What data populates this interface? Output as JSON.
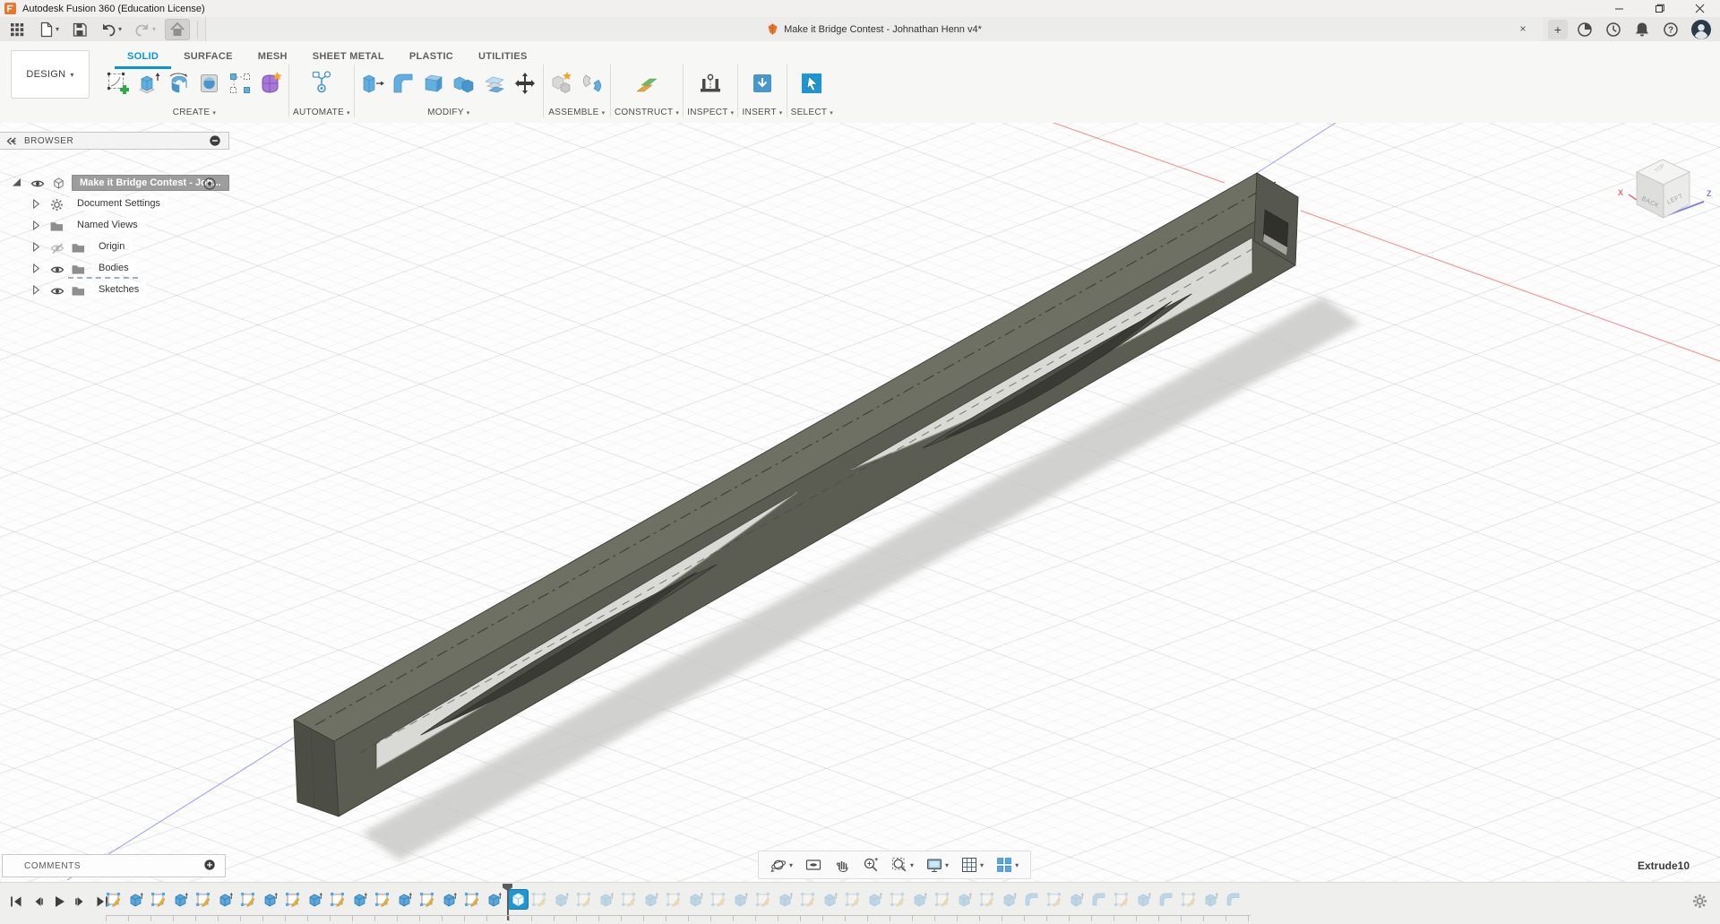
{
  "window": {
    "title": "Autodesk Fusion 360 (Education License)",
    "controls": [
      "minimize",
      "maximize",
      "close"
    ]
  },
  "appbar": {
    "left_icons": [
      {
        "name": "app-grid",
        "caret": false,
        "disabled": false
      },
      {
        "name": "file",
        "caret": true,
        "disabled": false
      },
      {
        "name": "save",
        "caret": false,
        "disabled": false
      },
      {
        "name": "undo",
        "caret": true,
        "disabled": false
      },
      {
        "name": "redo",
        "caret": true,
        "disabled": true
      },
      {
        "name": "home",
        "caret": false,
        "disabled": true
      }
    ],
    "tab": {
      "title": "Make it Bridge Contest - Johnathan Henn v4*",
      "icon": "document-cube",
      "close_label": "×"
    },
    "new_tab_label": "+",
    "right_icons": [
      "extensions",
      "job-status",
      "notifications",
      "help",
      "profile"
    ]
  },
  "ribbon": {
    "workspace_label": "DESIGN",
    "tabs": [
      {
        "label": "SOLID",
        "active": true
      },
      {
        "label": "SURFACE",
        "active": false
      },
      {
        "label": "MESH",
        "active": false
      },
      {
        "label": "SHEET METAL",
        "active": false
      },
      {
        "label": "PLASTIC",
        "active": false
      },
      {
        "label": "UTILITIES",
        "active": false
      }
    ],
    "groups": [
      {
        "label": "CREATE",
        "icons": [
          "create-sketch",
          "extrude",
          "revolve",
          "hole",
          "pattern",
          "create-form"
        ]
      },
      {
        "label": "AUTOMATE",
        "icons": [
          "automate"
        ]
      },
      {
        "label": "MODIFY",
        "icons": [
          "press-pull",
          "fillet",
          "shell",
          "combine",
          "split-body",
          "move"
        ]
      },
      {
        "label": "ASSEMBLE",
        "icons": [
          "new-component",
          "joint"
        ]
      },
      {
        "label": "CONSTRUCT",
        "icons": [
          "construct-plane"
        ]
      },
      {
        "label": "INSPECT",
        "icons": [
          "measure"
        ]
      },
      {
        "label": "INSERT",
        "icons": [
          "insert-mesh"
        ]
      },
      {
        "label": "SELECT",
        "icons": [
          "select-tool"
        ]
      }
    ]
  },
  "browser": {
    "header": "BROWSER",
    "items": [
      {
        "label": "Make it Bridge Contest - Joh...",
        "icon": "component-box",
        "caret": "expanded",
        "eye": "visible",
        "selected": true,
        "target": true,
        "indent": 0,
        "dashed": false
      },
      {
        "label": "Document Settings",
        "icon": "gear",
        "caret": "collapsed",
        "eye": "none",
        "selected": false,
        "target": false,
        "indent": 1,
        "dashed": false
      },
      {
        "label": "Named Views",
        "icon": "folder",
        "caret": "collapsed",
        "eye": "none",
        "selected": false,
        "target": false,
        "indent": 1,
        "dashed": false
      },
      {
        "label": "Origin",
        "icon": "folder",
        "caret": "collapsed",
        "eye": "hidden",
        "selected": false,
        "target": false,
        "indent": 1,
        "dashed": false
      },
      {
        "label": "Bodies",
        "icon": "folder",
        "caret": "collapsed",
        "eye": "visible",
        "selected": false,
        "target": false,
        "indent": 1,
        "dashed": true
      },
      {
        "label": "Sketches",
        "icon": "folder",
        "caret": "collapsed",
        "eye": "visible",
        "selected": false,
        "target": false,
        "indent": 1,
        "dashed": false
      }
    ]
  },
  "viewcube": {
    "top_label": "TOP",
    "left_face_label": "BACK",
    "right_face_label": "LEFT",
    "axis_x_label": "X",
    "axis_z_label": "Z"
  },
  "viewport": {
    "active_feature": "Extrude10"
  },
  "comments": {
    "label": "COMMENTS"
  },
  "nav_toolbar": [
    {
      "name": "orbit",
      "caret": true
    },
    {
      "name": "look-at",
      "caret": false
    },
    {
      "name": "pan",
      "caret": false
    },
    {
      "name": "zoom",
      "caret": false
    },
    {
      "name": "fit",
      "caret": true
    },
    {
      "name": "display-settings",
      "caret": true
    },
    {
      "name": "grid-settings",
      "caret": true
    },
    {
      "name": "viewports",
      "caret": true
    }
  ],
  "timeline": {
    "playback": [
      "go-to-start",
      "step-back",
      "play",
      "step-forward",
      "go-to-end"
    ],
    "features_done": [
      "sketch",
      "extrude",
      "sketch",
      "extrude",
      "sketch",
      "extrude",
      "sketch",
      "extrude",
      "sketch",
      "extrude",
      "sketch",
      "extrude",
      "sketch",
      "extrude",
      "sketch",
      "extrude",
      "sketch",
      "extrude"
    ],
    "feature_current": "extrude",
    "features_future": [
      "sketch",
      "extrude",
      "sketch",
      "extrude",
      "sketch",
      "extrude",
      "sketch",
      "extrude",
      "sketch",
      "extrude",
      "sketch",
      "extrude",
      "sketch",
      "extrude",
      "sketch",
      "extrude",
      "sketch",
      "extrude",
      "sketch",
      "extrude",
      "sketch",
      "extrude",
      "fillet",
      "sketch",
      "extrude",
      "fillet",
      "sketch",
      "extrude",
      "fillet",
      "sketch",
      "extrude",
      "fillet"
    ]
  },
  "colors": {
    "accent_blue": "#0696d7",
    "select_blue": "#1f95d4",
    "logo_orange": "#e8762d",
    "bridge_top": "#6e7064",
    "bridge_side": "#5b5d53",
    "axis_red": "#ef8a8a",
    "axis_blue": "#8a8aef"
  }
}
